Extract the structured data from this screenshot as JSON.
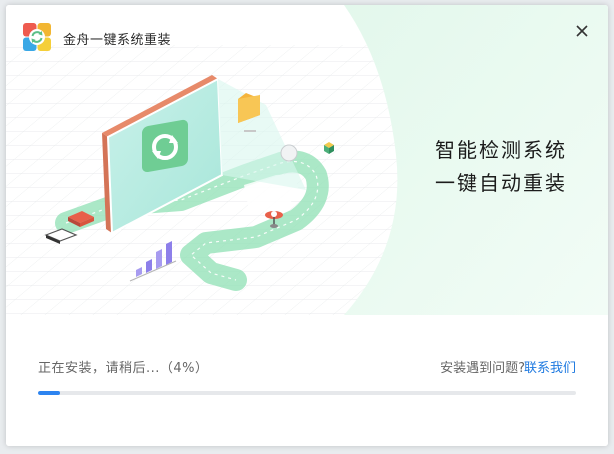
{
  "window": {
    "title": "金舟一键系统重装",
    "logo_icon": "app-logo-refresh-icon",
    "close_icon": "close-icon"
  },
  "hero": {
    "slogan_line1": "智能检测系统",
    "slogan_line2": "一键自动重装",
    "illustration": "isometric-computer-reinstall-illustration"
  },
  "install": {
    "status_text": "正在安装，请稍后...（4%）",
    "progress_percent": 4,
    "issue_prompt": "安装遇到问题?",
    "contact_link": "联系我们"
  },
  "colors": {
    "accent_green": "#5fcf97",
    "progress_blue": "#2d84f0",
    "link_blue": "#1f7ae0",
    "hero_bg": "#eafaf1"
  }
}
